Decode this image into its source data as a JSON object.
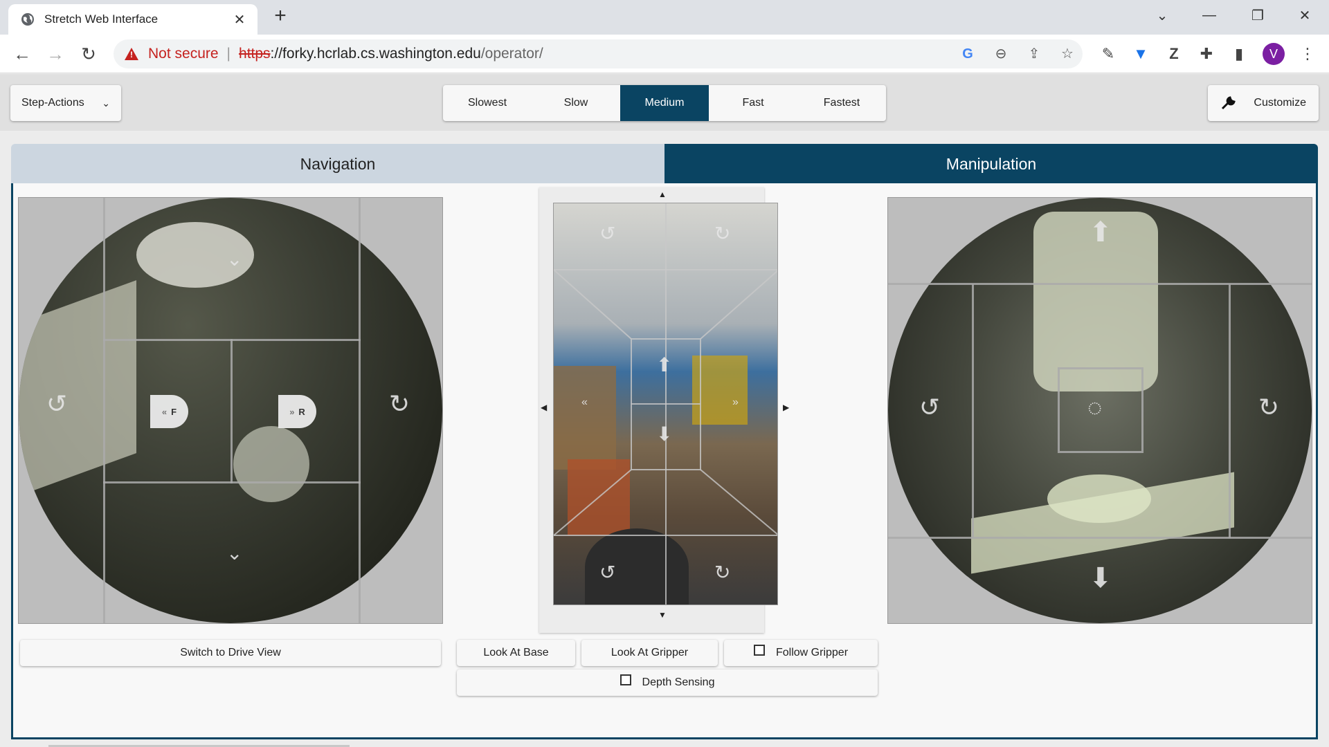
{
  "browser": {
    "tab_title": "Stretch Web Interface",
    "new_tab_label": "+",
    "security_label": "Not secure",
    "url_scheme": "https",
    "url_host": "://forky.hcrlab.cs.washington.edu",
    "url_path": "/operator/",
    "avatar_letter": "V"
  },
  "topbar": {
    "step_actions_label": "Step-Actions",
    "speeds": [
      "Slowest",
      "Slow",
      "Medium",
      "Fast",
      "Fastest"
    ],
    "active_speed": "Medium",
    "customize_label": "Customize"
  },
  "modes": {
    "navigation_label": "Navigation",
    "manipulation_label": "Manipulation",
    "active": "Manipulation"
  },
  "controls": {
    "switch_drive_label": "Switch to Drive View",
    "look_base_label": "Look At Base",
    "look_gripper_label": "Look At Gripper",
    "follow_gripper_label": "Follow Gripper",
    "follow_gripper_checked": false,
    "depth_sensing_label": "Depth Sensing",
    "depth_sensing_checked": false
  },
  "overlays": {
    "forward_label": "F",
    "reverse_label": "R"
  },
  "colors": {
    "accent": "#0a4462",
    "inactive_tab": "#ccd6e0",
    "insecure": "#c5221f"
  }
}
